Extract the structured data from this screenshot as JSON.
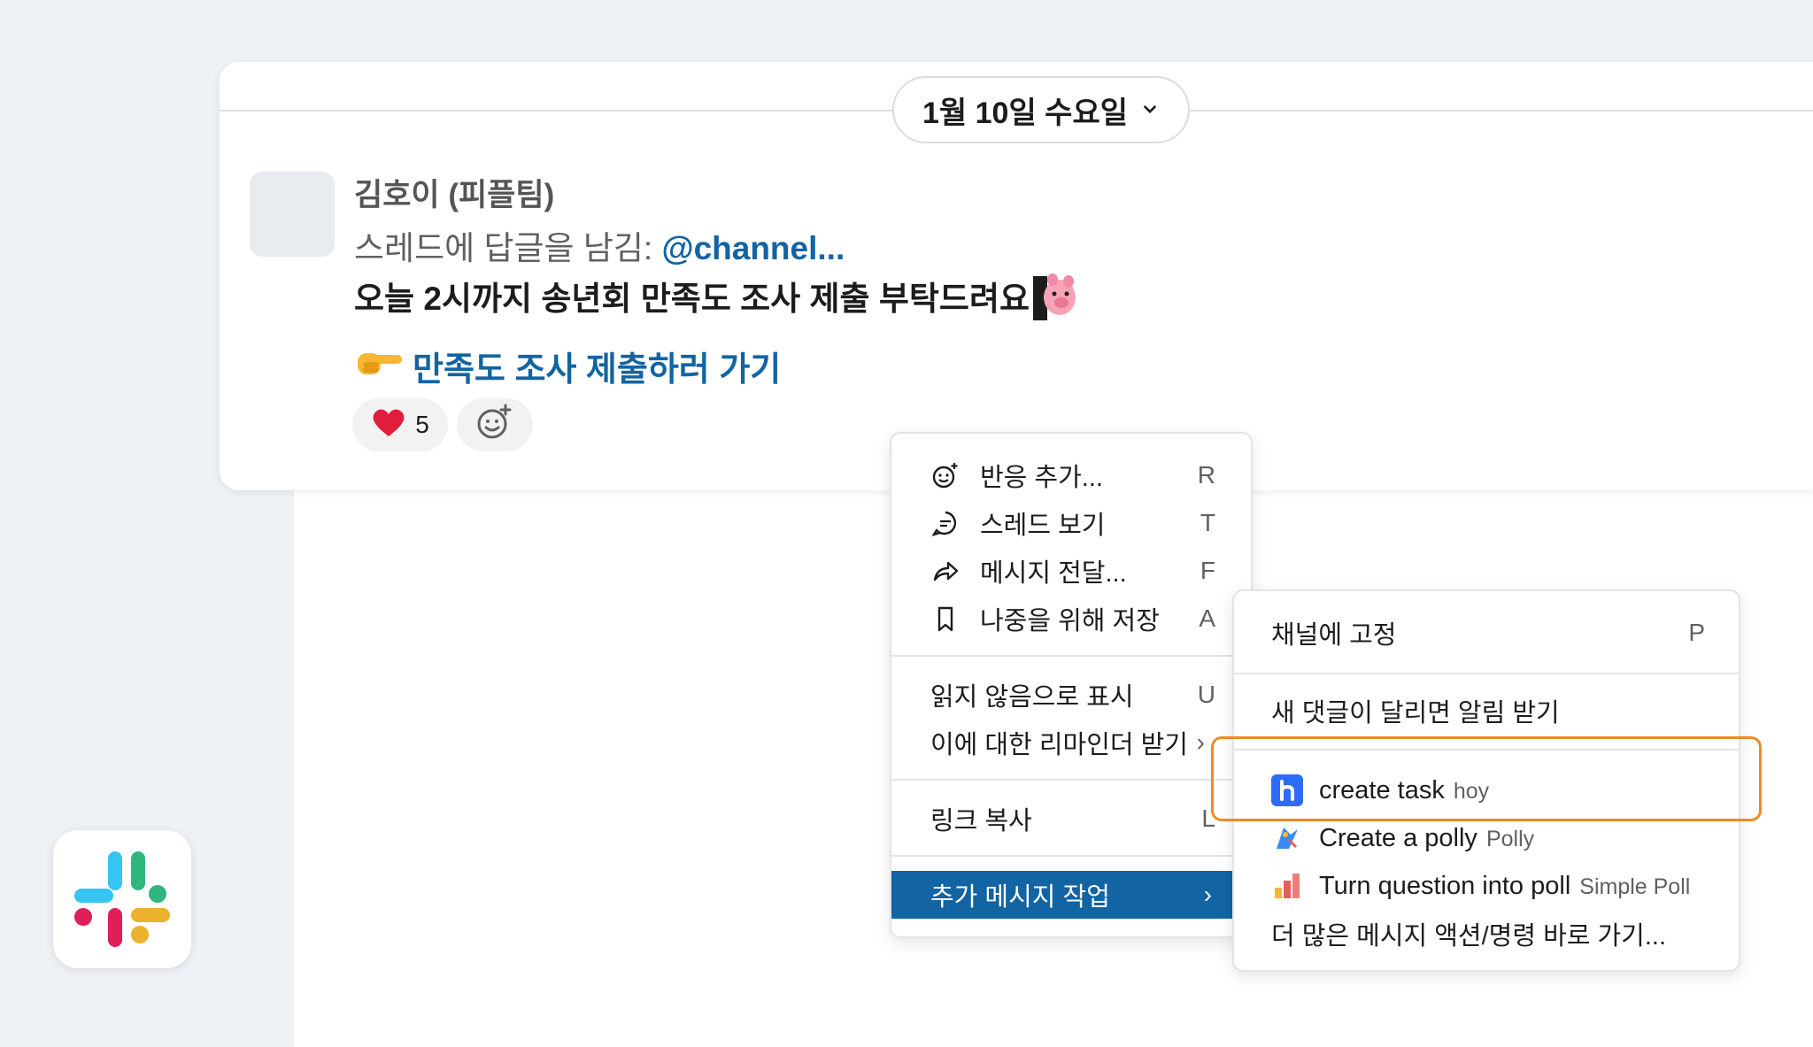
{
  "date_divider": {
    "label": "1월 10일 수요일"
  },
  "message": {
    "sender": "김호이 (피플팀)",
    "thread_prefix": "스레드에 답글을 남김: ",
    "mention": "@channel...",
    "text": "오늘 2시까지 송년회 만족도 조사 제출 부탁드려요",
    "link_text": "만족도 조사 제출하러 가기",
    "reactions": [
      {
        "emoji": "❤️",
        "count": "5"
      }
    ]
  },
  "context_menu": {
    "items": [
      {
        "label": "반응 추가...",
        "key": "R",
        "icon": "add-reaction-icon"
      },
      {
        "label": "스레드 보기",
        "key": "T",
        "icon": "thread-icon"
      },
      {
        "label": "메시지 전달...",
        "key": "F",
        "icon": "forward-icon"
      },
      {
        "label": "나중을 위해 저장",
        "key": "A",
        "icon": "bookmark-icon"
      },
      {
        "label": "읽지 않음으로 표시",
        "key": "U"
      },
      {
        "label": "이에 대한 리마인더 받기",
        "key": "›"
      },
      {
        "label": "링크 복사",
        "key": "L"
      },
      {
        "label": "추가 메시지 작업",
        "key": "›"
      }
    ]
  },
  "submenu": {
    "pin": {
      "label": "채널에 고정",
      "key": "P"
    },
    "notify": {
      "label": "새 댓글이 달리면 알림 받기"
    },
    "apps": [
      {
        "label": "create task",
        "app": "hoy",
        "color": "#2d6cf6"
      },
      {
        "label": "Create a polly",
        "app": "Polly",
        "color": "#3a8bf7"
      },
      {
        "label": "Turn question into poll",
        "app": "Simple Poll",
        "color": "#e85d5d"
      }
    ],
    "more": {
      "label": "더 많은 메시지 액션/명령 바로 가기..."
    }
  }
}
